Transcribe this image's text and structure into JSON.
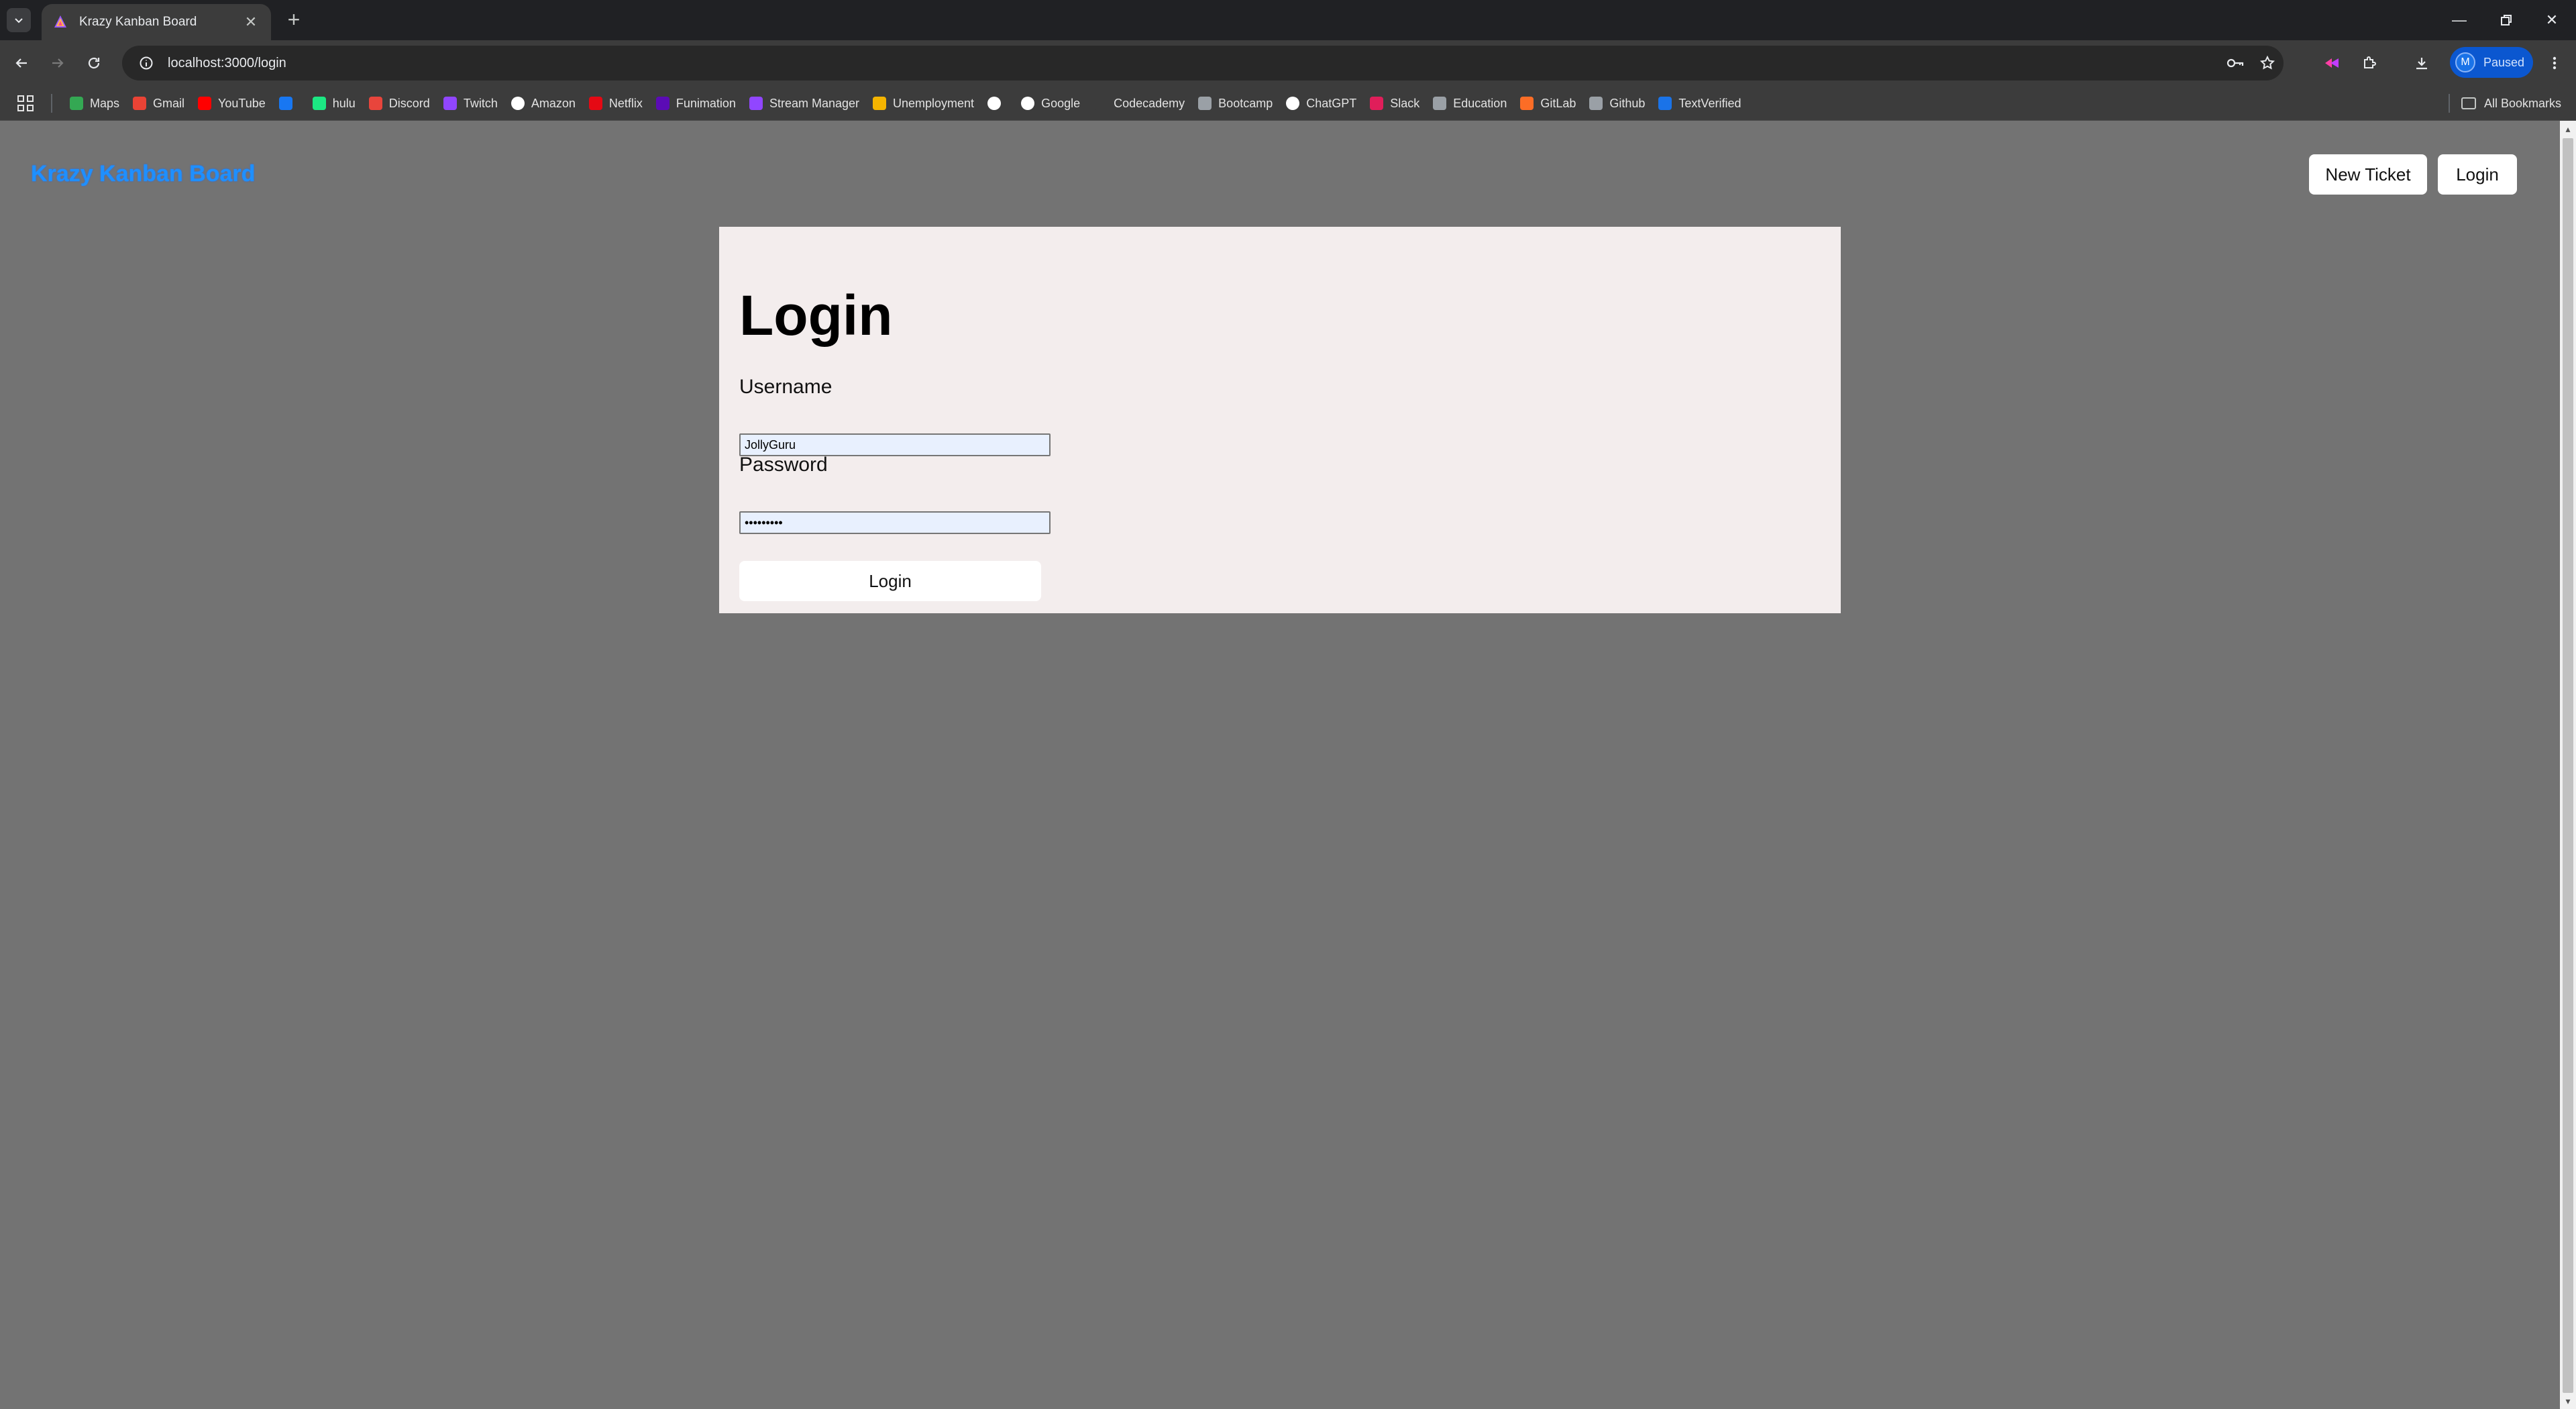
{
  "browser": {
    "tab_title": "Krazy Kanban Board",
    "url": "localhost:3000/login",
    "profile_initial": "M",
    "profile_status": "Paused",
    "bookmarks": [
      {
        "label": "Maps",
        "icon": "maps-icon",
        "color": "#34a853"
      },
      {
        "label": "Gmail",
        "icon": "gmail-icon",
        "color": "#ea4335"
      },
      {
        "label": "YouTube",
        "icon": "youtube-icon",
        "color": "#ff0000"
      },
      {
        "label": "",
        "icon": "facebook-icon",
        "color": "#1877f2"
      },
      {
        "label": "hulu",
        "icon": "hulu-icon",
        "color": "#1ce783"
      },
      {
        "label": "Discord",
        "icon": "discord-icon",
        "color": "#e8453c"
      },
      {
        "label": "Twitch",
        "icon": "twitch-icon",
        "color": "#9146ff"
      },
      {
        "label": "Amazon",
        "icon": "amazon-icon",
        "color": "#ffffff"
      },
      {
        "label": "Netflix",
        "icon": "netflix-icon",
        "color": "#e50914"
      },
      {
        "label": "Funimation",
        "icon": "funimation-icon",
        "color": "#5b0bb5"
      },
      {
        "label": "Stream Manager",
        "icon": "twitch-icon",
        "color": "#9146ff"
      },
      {
        "label": "Unemployment",
        "icon": "lightning-icon",
        "color": "#f4b400"
      },
      {
        "label": "",
        "icon": "info-icon",
        "color": "#ffffff"
      },
      {
        "label": "Google",
        "icon": "google-icon",
        "color": "#ffffff"
      },
      {
        "label": "Codecademy",
        "icon": "codecademy-icon",
        "color": "#3c3c3c"
      },
      {
        "label": "Bootcamp",
        "icon": "globe-icon",
        "color": "#9aa0a6"
      },
      {
        "label": "ChatGPT",
        "icon": "chatgpt-icon",
        "color": "#ffffff"
      },
      {
        "label": "Slack",
        "icon": "slack-icon",
        "color": "#e01e5a"
      },
      {
        "label": "Education",
        "icon": "github-icon",
        "color": "#9aa0a6"
      },
      {
        "label": "GitLab",
        "icon": "gitlab-icon",
        "color": "#fc6d26"
      },
      {
        "label": "Github",
        "icon": "github-icon",
        "color": "#9aa0a6"
      },
      {
        "label": "TextVerified",
        "icon": "textverified-icon",
        "color": "#1a73e8"
      }
    ],
    "all_bookmarks_label": "All Bookmarks"
  },
  "app": {
    "brand": "Krazy Kanban Board",
    "brand_color": "#1e90ff",
    "nav": {
      "new_ticket_label": "New Ticket",
      "login_label": "Login"
    },
    "login": {
      "title": "Login",
      "username_label": "Username",
      "username_value": "JollyGuru",
      "password_label": "Password",
      "password_value": "•••••••••",
      "submit_label": "Login"
    }
  }
}
